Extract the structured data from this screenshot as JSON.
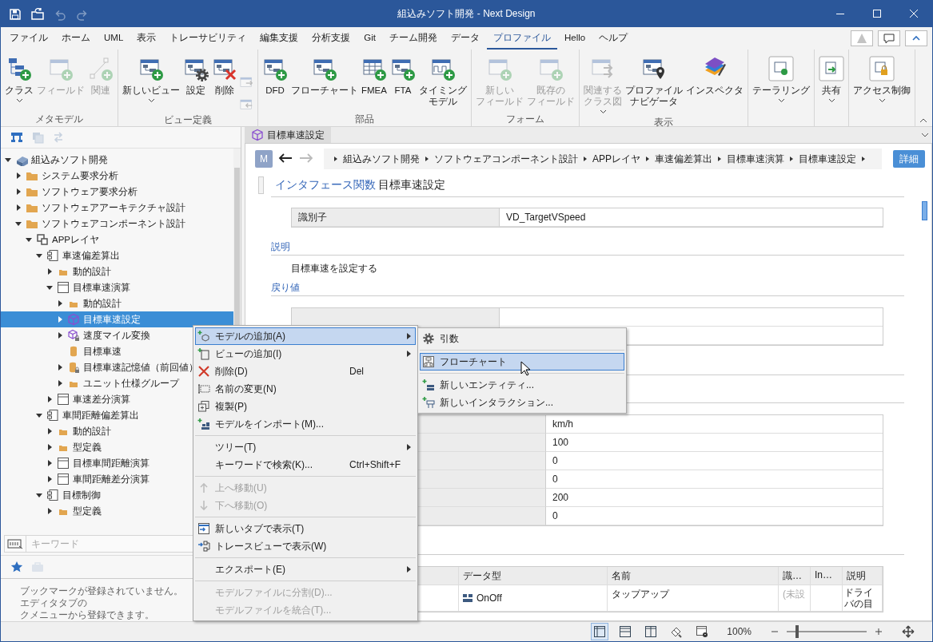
{
  "title_bar": {
    "title": "組込みソフト開発 - Next Design",
    "quick_access": [
      {
        "kind": "save",
        "disabled": false
      },
      {
        "kind": "open",
        "disabled": false
      },
      {
        "kind": "undo",
        "disabled": true
      },
      {
        "kind": "redo",
        "disabled": true
      }
    ]
  },
  "menu_tabs": [
    {
      "label": "ファイル",
      "selected": false
    },
    {
      "label": "ホーム",
      "selected": false
    },
    {
      "label": "UML",
      "selected": false
    },
    {
      "label": "表示",
      "selected": false
    },
    {
      "label": "トレーサビリティ",
      "selected": false
    },
    {
      "label": "編集支援",
      "selected": false
    },
    {
      "label": "分析支援",
      "selected": false
    },
    {
      "label": "Git",
      "selected": false
    },
    {
      "label": "チーム開発",
      "selected": false
    },
    {
      "label": "データ",
      "selected": false
    },
    {
      "label": "プロファイル",
      "selected": true
    },
    {
      "label": "Hello",
      "selected": false
    },
    {
      "label": "ヘルプ",
      "selected": false
    }
  ],
  "corner_buttons": [
    {
      "kind": "logo",
      "disabled": true
    },
    {
      "kind": "comment",
      "disabled": false
    },
    {
      "kind": "collapse",
      "disabled": false
    }
  ],
  "ribbon": {
    "groups": [
      {
        "label": "メタモデル",
        "buttons": [
          {
            "lines": [
              "クラス"
            ],
            "kind": "class",
            "dropdown": true,
            "disabled": false
          },
          {
            "lines": [
              "フィールド"
            ],
            "kind": "field",
            "dropdown": false,
            "disabled": true
          },
          {
            "lines": [
              "関連"
            ],
            "kind": "relation",
            "dropdown": false,
            "disabled": true
          }
        ]
      },
      {
        "label": "ビュー定義",
        "buttons": [
          {
            "lines": [
              "新しいビュー"
            ],
            "kind": "new-view",
            "dropdown": true,
            "disabled": false
          },
          {
            "lines": [
              "設定"
            ],
            "kind": "settings",
            "dropdown": false,
            "disabled": false
          },
          {
            "lines": [
              "削除"
            ],
            "kind": "delete-view",
            "dropdown": false,
            "disabled": false
          }
        ],
        "small_buttons": [
          {
            "kind": "move-in",
            "disabled": true
          },
          {
            "kind": "move-out",
            "disabled": true
          }
        ]
      },
      {
        "label": "部品",
        "buttons": [
          {
            "lines": [
              "DFD"
            ],
            "kind": "dfd",
            "dropdown": false,
            "disabled": false
          },
          {
            "lines": [
              "フローチャート"
            ],
            "kind": "flowchart",
            "dropdown": false,
            "disabled": false
          },
          {
            "lines": [
              "FMEA"
            ],
            "kind": "fmea",
            "dropdown": false,
            "disabled": false
          },
          {
            "lines": [
              "FTA"
            ],
            "kind": "fta",
            "dropdown": false,
            "disabled": false
          },
          {
            "lines": [
              "タイミング",
              "モデル"
            ],
            "kind": "timing",
            "dropdown": false,
            "disabled": false
          }
        ]
      },
      {
        "label": "フォーム",
        "buttons": [
          {
            "lines": [
              "新しい",
              "フィールド"
            ],
            "kind": "new-field",
            "dropdown": false,
            "disabled": true
          },
          {
            "lines": [
              "既存の",
              "フィールド"
            ],
            "kind": "existing-field",
            "dropdown": false,
            "disabled": true
          }
        ]
      },
      {
        "label": "表示",
        "buttons": [
          {
            "lines": [
              "関連する",
              "クラス図"
            ],
            "kind": "related-class",
            "dropdown": true,
            "disabled": true
          },
          {
            "lines": [
              "プロファイル",
              "ナビゲータ"
            ],
            "kind": "navigator",
            "dropdown": false,
            "disabled": false
          },
          {
            "lines": [
              "インスペクタ"
            ],
            "kind": "inspector",
            "dropdown": false,
            "disabled": false
          }
        ]
      },
      {
        "buttons": [
          {
            "lines": [
              "テーラリング"
            ],
            "kind": "tailoring",
            "dropdown": true,
            "disabled": false
          }
        ]
      },
      {
        "buttons": [
          {
            "lines": [
              "共有"
            ],
            "kind": "share",
            "dropdown": true,
            "disabled": false
          }
        ]
      },
      {
        "buttons": [
          {
            "lines": [
              "アクセス制御"
            ],
            "kind": "access",
            "dropdown": true,
            "disabled": false
          }
        ]
      }
    ]
  },
  "tree_toolbar": [
    {
      "kind": "hierarchy",
      "disabled": false
    },
    {
      "kind": "stack",
      "disabled": true
    },
    {
      "kind": "sync",
      "disabled": true
    }
  ],
  "tree": [
    {
      "label": "組込みソフト開発",
      "kind": "model",
      "expanded": true,
      "selected": false,
      "children": [
        {
          "label": "システム要求分析",
          "kind": "folder",
          "expanded": false,
          "selected": false
        },
        {
          "label": "ソフトウェア要求分析",
          "kind": "folder",
          "expanded": false,
          "selected": false
        },
        {
          "label": "ソフトウェアアーキテクチャ設計",
          "kind": "folder",
          "expanded": false,
          "selected": false
        },
        {
          "label": "ソフトウェアコンポーネント設計",
          "kind": "folder",
          "expanded": true,
          "selected": false,
          "children": [
            {
              "label": "APPレイヤ",
              "kind": "layer",
              "expanded": true,
              "selected": false,
              "children": [
                {
                  "label": "車速偏差算出",
                  "kind": "component",
                  "expanded": true,
                  "selected": false,
                  "children": [
                    {
                      "label": "動的設計",
                      "kind": "small-folder",
                      "expanded": false,
                      "selected": false
                    },
                    {
                      "label": "目標車速演算",
                      "kind": "class",
                      "expanded": true,
                      "selected": false,
                      "children": [
                        {
                          "label": "動的設計",
                          "kind": "small-folder",
                          "expanded": false,
                          "selected": false
                        },
                        {
                          "label": "目標車速設定",
                          "kind": "cube",
                          "expanded": false,
                          "selected": true
                        },
                        {
                          "label": "速度マイル変換",
                          "kind": "cube-lock",
                          "expanded": false,
                          "selected": false
                        },
                        {
                          "label": "目標車速",
                          "kind": "cylinder",
                          "selected": false
                        },
                        {
                          "label": "目標車速記憶値（前回値）",
                          "kind": "cylinder-lock",
                          "expanded": false,
                          "selected": false
                        },
                        {
                          "label": "ユニット仕様グループ",
                          "kind": "small-folder",
                          "expanded": false,
                          "selected": false
                        }
                      ]
                    },
                    {
                      "label": "車速差分演算",
                      "kind": "class",
                      "expanded": false,
                      "selected": false
                    }
                  ]
                },
                {
                  "label": "車間距離偏差算出",
                  "kind": "component",
                  "expanded": true,
                  "selected": false,
                  "children": [
                    {
                      "label": "動的設計",
                      "kind": "small-folder",
                      "expanded": false,
                      "selected": false
                    },
                    {
                      "label": "型定義",
                      "kind": "small-folder",
                      "expanded": false,
                      "selected": false
                    },
                    {
                      "label": "目標車間距離演算",
                      "kind": "class",
                      "expanded": false,
                      "selected": false
                    },
                    {
                      "label": "車間距離差分演算",
                      "kind": "class",
                      "expanded": false,
                      "selected": false
                    }
                  ]
                },
                {
                  "label": "目標制御",
                  "kind": "component",
                  "expanded": true,
                  "selected": false,
                  "children": [
                    {
                      "label": "型定義",
                      "kind": "small-folder",
                      "expanded": false,
                      "selected": false
                    }
                  ]
                }
              ]
            }
          ]
        }
      ]
    }
  ],
  "keyword_field": {
    "placeholder": "キーワード"
  },
  "bookmark_toolbar": [
    {
      "kind": "star",
      "selected": true
    },
    {
      "kind": "toolbox",
      "selected": false
    }
  ],
  "bookmark_message": [
    "ブックマークが登録されていません。エディタタブの",
    "クメニューから登録できます。"
  ],
  "editor_tab": {
    "label": "目標車速設定"
  },
  "breadcrumb": {
    "badge": "M",
    "back": {
      "disabled": false
    },
    "forward": {
      "disabled": true
    },
    "items": [
      "組込みソフト開発",
      "ソフトウェアコンポーネント設計",
      "APPレイヤ",
      "車速偏差算出",
      "目標車速演算",
      "目標車速設定"
    ],
    "detail_button": "詳細"
  },
  "heading": {
    "type": "インタフェース関数",
    "name": "目標車速設定"
  },
  "identifier_row": {
    "label": "識別子",
    "value": "VD_TargetVSpeed"
  },
  "description": {
    "title": "説明",
    "text": "目標車速を設定する"
  },
  "return_value": {
    "title": "戻り値"
  },
  "property_values": [
    "km/h",
    "100",
    "0",
    "0",
    "200",
    "0"
  ],
  "parameters": {
    "columns": [
      "データ型",
      "名前",
      "識…",
      "In…",
      "説明"
    ],
    "rows": [
      {
        "data_type": "OnOff",
        "name": "タップアップ",
        "column_3": "(未設",
        "description": "ドライバの目"
      }
    ]
  },
  "status_bar": {
    "tools": [
      {
        "kind": "layout-left",
        "selected": true
      },
      {
        "kind": "layout-bottom",
        "selected": false
      },
      {
        "kind": "layout-split",
        "selected": false
      },
      {
        "kind": "brush",
        "selected": false
      },
      {
        "kind": "window-gear",
        "selected": false
      }
    ],
    "zoom": "100%",
    "zoom_slider": {
      "level": 0.13
    }
  },
  "context_menu": [
    {
      "kind": "add-model",
      "label": "モデルの追加(A)",
      "submenu": true,
      "disabled": false,
      "selected": true
    },
    {
      "kind": "add-view",
      "label": "ビューの追加(I)",
      "submenu": true,
      "disabled": false,
      "selected": false
    },
    {
      "kind": "delete",
      "label": "削除(D)",
      "shortcut": "Del",
      "submenu": false,
      "disabled": false,
      "selected": false
    },
    {
      "kind": "rename",
      "label": "名前の変更(N)",
      "submenu": false,
      "disabled": false,
      "selected": false
    },
    {
      "kind": "duplicate",
      "label": "複製(P)",
      "submenu": false,
      "disabled": false,
      "selected": false
    },
    {
      "kind": "import",
      "label": "モデルをインポート(M)...",
      "submenu": false,
      "disabled": false,
      "selected": false
    },
    {
      "kind": "separator"
    },
    {
      "kind": "text",
      "label": "ツリー(T)",
      "submenu": true,
      "disabled": false,
      "selected": false
    },
    {
      "kind": "text",
      "label": "キーワードで検索(K)...",
      "shortcut": "Ctrl+Shift+F",
      "submenu": false,
      "disabled": false,
      "selected": false
    },
    {
      "kind": "separator"
    },
    {
      "kind": "up",
      "label": "上へ移動(U)",
      "submenu": false,
      "disabled": true,
      "selected": false
    },
    {
      "kind": "down",
      "label": "下へ移動(O)",
      "submenu": false,
      "disabled": true,
      "selected": false
    },
    {
      "kind": "separator"
    },
    {
      "kind": "new-tab",
      "label": "新しいタブで表示(T)",
      "submenu": false,
      "disabled": false,
      "selected": false
    },
    {
      "kind": "trace",
      "label": "トレースビューで表示(W)",
      "submenu": false,
      "disabled": false,
      "selected": false
    },
    {
      "kind": "separator"
    },
    {
      "kind": "text",
      "label": "エクスポート(E)",
      "submenu": true,
      "disabled": false,
      "selected": false
    },
    {
      "kind": "separator"
    },
    {
      "kind": "text",
      "label": "モデルファイルに分割(D)...",
      "submenu": false,
      "disabled": true,
      "selected": false
    },
    {
      "kind": "text",
      "label": "モデルファイルを統合(T)...",
      "submenu": false,
      "disabled": true,
      "selected": false
    }
  ],
  "submenu": [
    {
      "kind": "gear",
      "label": "引数",
      "disabled": false,
      "selected": false
    },
    {
      "kind": "separator"
    },
    {
      "kind": "flowchart",
      "label": "フローチャート",
      "disabled": false,
      "selected": true
    },
    {
      "kind": "separator"
    },
    {
      "kind": "entity",
      "label": "新しいエンティティ...",
      "disabled": false,
      "selected": false
    },
    {
      "kind": "interaction",
      "label": "新しいインタラクション...",
      "disabled": false,
      "selected": false
    }
  ]
}
